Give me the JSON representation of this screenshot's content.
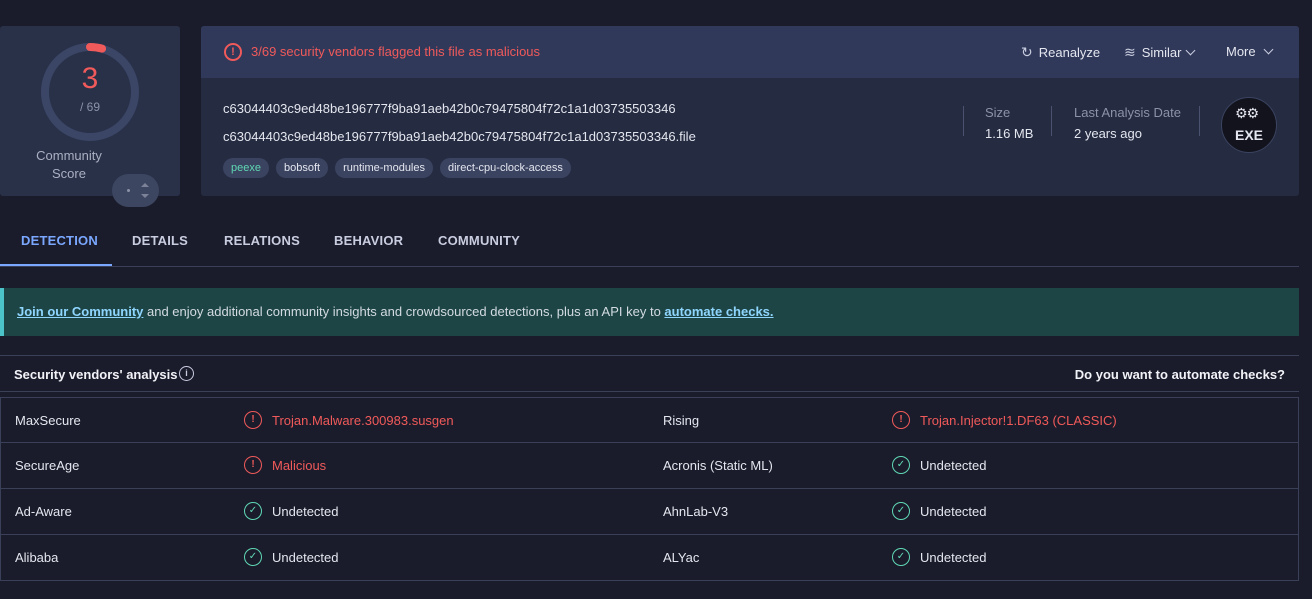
{
  "score": {
    "detected": "3",
    "total": "/ 69",
    "community_label_1": "Community",
    "community_label_2": "Score",
    "fraction": 0.0435
  },
  "colors": {
    "malicious": "#f05a5a",
    "clean": "#5fd8b4",
    "accent": "#7aa7ff",
    "banner_bg": "#1e4546"
  },
  "header": {
    "alert_text": "3/69 security vendors flagged this file as malicious",
    "reanalyze": "Reanalyze",
    "similar": "Similar",
    "more": "More"
  },
  "file": {
    "hash": "c63044403c9ed48be196777f9ba91aeb42b0c79475804f72c1a1d03735503346",
    "name": "c63044403c9ed48be196777f9ba91aeb42b0c79475804f72c1a1d03735503346.file",
    "tags": [
      "peexe",
      "bobsoft",
      "runtime-modules",
      "direct-cpu-clock-access"
    ],
    "size_label": "Size",
    "size_value": "1.16 MB",
    "date_label": "Last Analysis Date",
    "date_value": "2 years ago",
    "type_badge": "EXE",
    "type_icon": "gears-icon"
  },
  "tabs": [
    {
      "label": "DETECTION"
    },
    {
      "label": "DETAILS"
    },
    {
      "label": "RELATIONS"
    },
    {
      "label": "BEHAVIOR"
    },
    {
      "label": "COMMUNITY"
    }
  ],
  "banner": {
    "link1": "Join our Community",
    "middle": " and enjoy additional community insights and crowdsourced detections, plus an API key to ",
    "link2": "automate checks."
  },
  "vendors": {
    "title": "Security vendors' analysis",
    "automate": "Do you want to automate checks?",
    "rows": [
      {
        "left_name": "MaxSecure",
        "left_result": "Trojan.Malware.300983.susgen",
        "right_name": "Rising",
        "right_result": "Trojan.Injector!1.DF63 (CLASSIC)"
      },
      {
        "left_name": "SecureAge",
        "left_result": "Malicious",
        "right_name": "Acronis (Static ML)",
        "right_result": "Undetected"
      },
      {
        "left_name": "Ad-Aware",
        "left_result": "Undetected",
        "right_name": "AhnLab-V3",
        "right_result": "Undetected"
      },
      {
        "left_name": "Alibaba",
        "left_result": "Undetected",
        "right_name": "ALYac",
        "right_result": "Undetected"
      }
    ]
  }
}
